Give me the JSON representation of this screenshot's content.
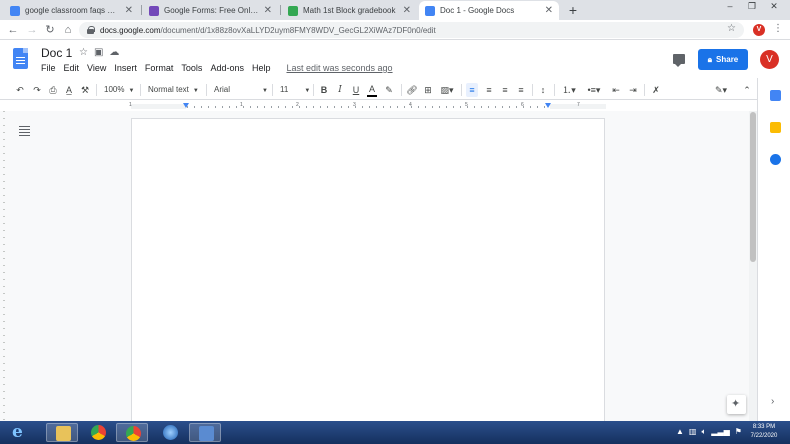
{
  "tabs": [
    {
      "title": "google classroom faqs article.do",
      "favicon_color": "#4285f4",
      "active": false
    },
    {
      "title": "Google Forms: Free Online Surve",
      "favicon_color": "#7248b9",
      "active": false
    },
    {
      "title": "Math 1st Block gradebook",
      "favicon_color": "#34a853",
      "active": false
    },
    {
      "title": "Doc 1 - Google Docs",
      "favicon_color": "#4285f4",
      "active": true
    }
  ],
  "window": {
    "minimize": "–",
    "restore": "❐",
    "close": "✕"
  },
  "address": {
    "host": "docs.google.com",
    "path": "/document/d/1x88z8ovXaLLYD2uym8FMY8WDV_GecGL2XiWAz7DF0n0/edit"
  },
  "profile_initial": "V",
  "doc": {
    "title": "Doc 1",
    "menus": [
      "File",
      "Edit",
      "View",
      "Insert",
      "Format",
      "Tools",
      "Add-ons",
      "Help"
    ],
    "last_edit": "Last edit was seconds ago",
    "share_label": "Share"
  },
  "toolbar": {
    "zoom": "100%",
    "style": "Normal text",
    "font": "Arial",
    "size": "11"
  },
  "ruler_numbers": [
    "1",
    "1",
    "2",
    "3",
    "4",
    "5",
    "6",
    "7"
  ],
  "taskbar": {
    "time": "8:33 PM",
    "date": "7/22/2020"
  },
  "colors": {
    "accent": "#1a73e8",
    "taskbar": "#1f3a6e",
    "avatar": "#d93025"
  }
}
